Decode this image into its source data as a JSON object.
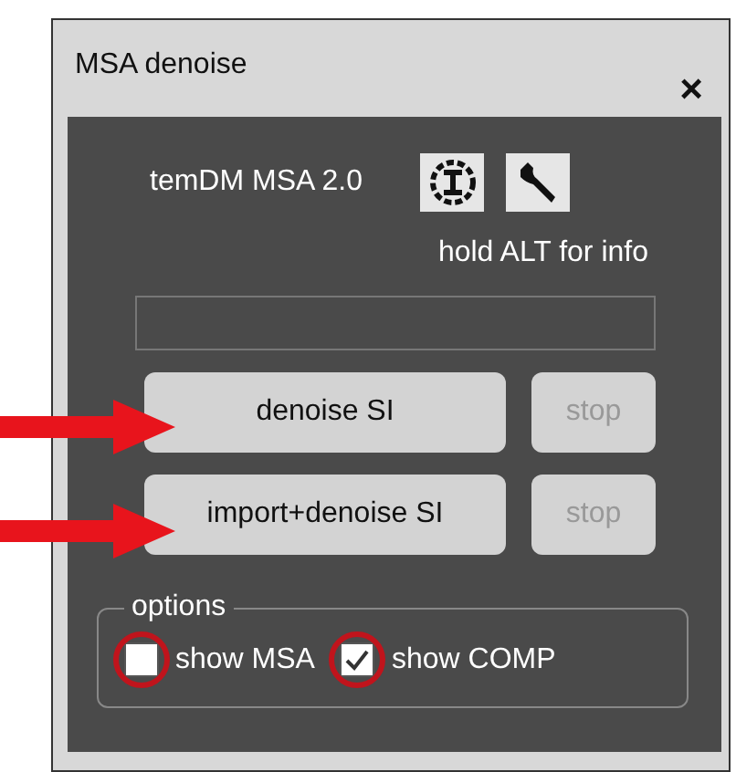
{
  "window": {
    "title": "MSA denoise",
    "close": "×"
  },
  "header": {
    "title": "temDM MSA 2.0",
    "hint": "hold ALT for info"
  },
  "actions": [
    {
      "label": "denoise SI",
      "disabled": false,
      "stop": {
        "label": "stop",
        "disabled": true
      }
    },
    {
      "label": "import+denoise SI",
      "disabled": false,
      "stop": {
        "label": "stop",
        "disabled": true
      }
    }
  ],
  "options": {
    "legend": "options",
    "items": [
      {
        "label": "show MSA",
        "checked": false
      },
      {
        "label": "show COMP",
        "checked": true
      }
    ]
  }
}
